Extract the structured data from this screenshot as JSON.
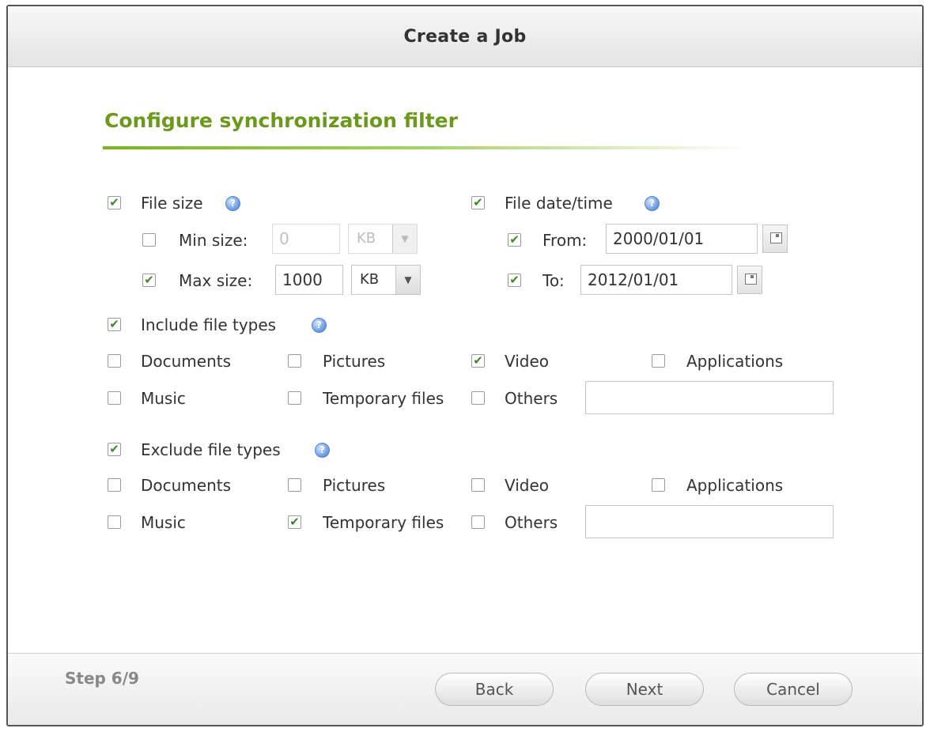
{
  "dialog": {
    "title": "Create a Job"
  },
  "section": {
    "title": "Configure synchronization filter"
  },
  "file_size": {
    "label": "File size",
    "checked": true,
    "min": {
      "label": "Min size:",
      "checked": false,
      "value": "0",
      "unit": "KB"
    },
    "max": {
      "label": "Max size:",
      "checked": true,
      "value": "1000",
      "unit": "KB"
    }
  },
  "file_datetime": {
    "label": "File date/time",
    "checked": true,
    "from": {
      "label": "From:",
      "checked": true,
      "value": "2000/01/01"
    },
    "to": {
      "label": "To:",
      "checked": true,
      "value": "2012/01/01"
    }
  },
  "include": {
    "label": "Include file types",
    "checked": true,
    "types": [
      {
        "label": "Documents",
        "checked": false
      },
      {
        "label": "Pictures",
        "checked": false
      },
      {
        "label": "Video",
        "checked": true
      },
      {
        "label": "Applications",
        "checked": false
      },
      {
        "label": "Music",
        "checked": false
      },
      {
        "label": "Temporary files",
        "checked": false
      },
      {
        "label": "Others",
        "checked": false
      }
    ],
    "others_value": ""
  },
  "exclude": {
    "label": "Exclude file types",
    "checked": true,
    "types": [
      {
        "label": "Documents",
        "checked": false
      },
      {
        "label": "Pictures",
        "checked": false
      },
      {
        "label": "Video",
        "checked": false
      },
      {
        "label": "Applications",
        "checked": false
      },
      {
        "label": "Music",
        "checked": false
      },
      {
        "label": "Temporary files",
        "checked": true
      },
      {
        "label": "Others",
        "checked": false
      }
    ],
    "others_value": ""
  },
  "footer": {
    "step": "Step 6/9",
    "back_label": "Back",
    "next_label": "Next",
    "cancel_label": "Cancel"
  },
  "colors": {
    "accent_green": "#6a9a1a",
    "check_green": "#3c8a20",
    "help_blue": "#3e76c9"
  },
  "icons": {
    "help": "help-icon",
    "calendar": "calendar-icon",
    "dropdown": "chevron-down-icon"
  }
}
